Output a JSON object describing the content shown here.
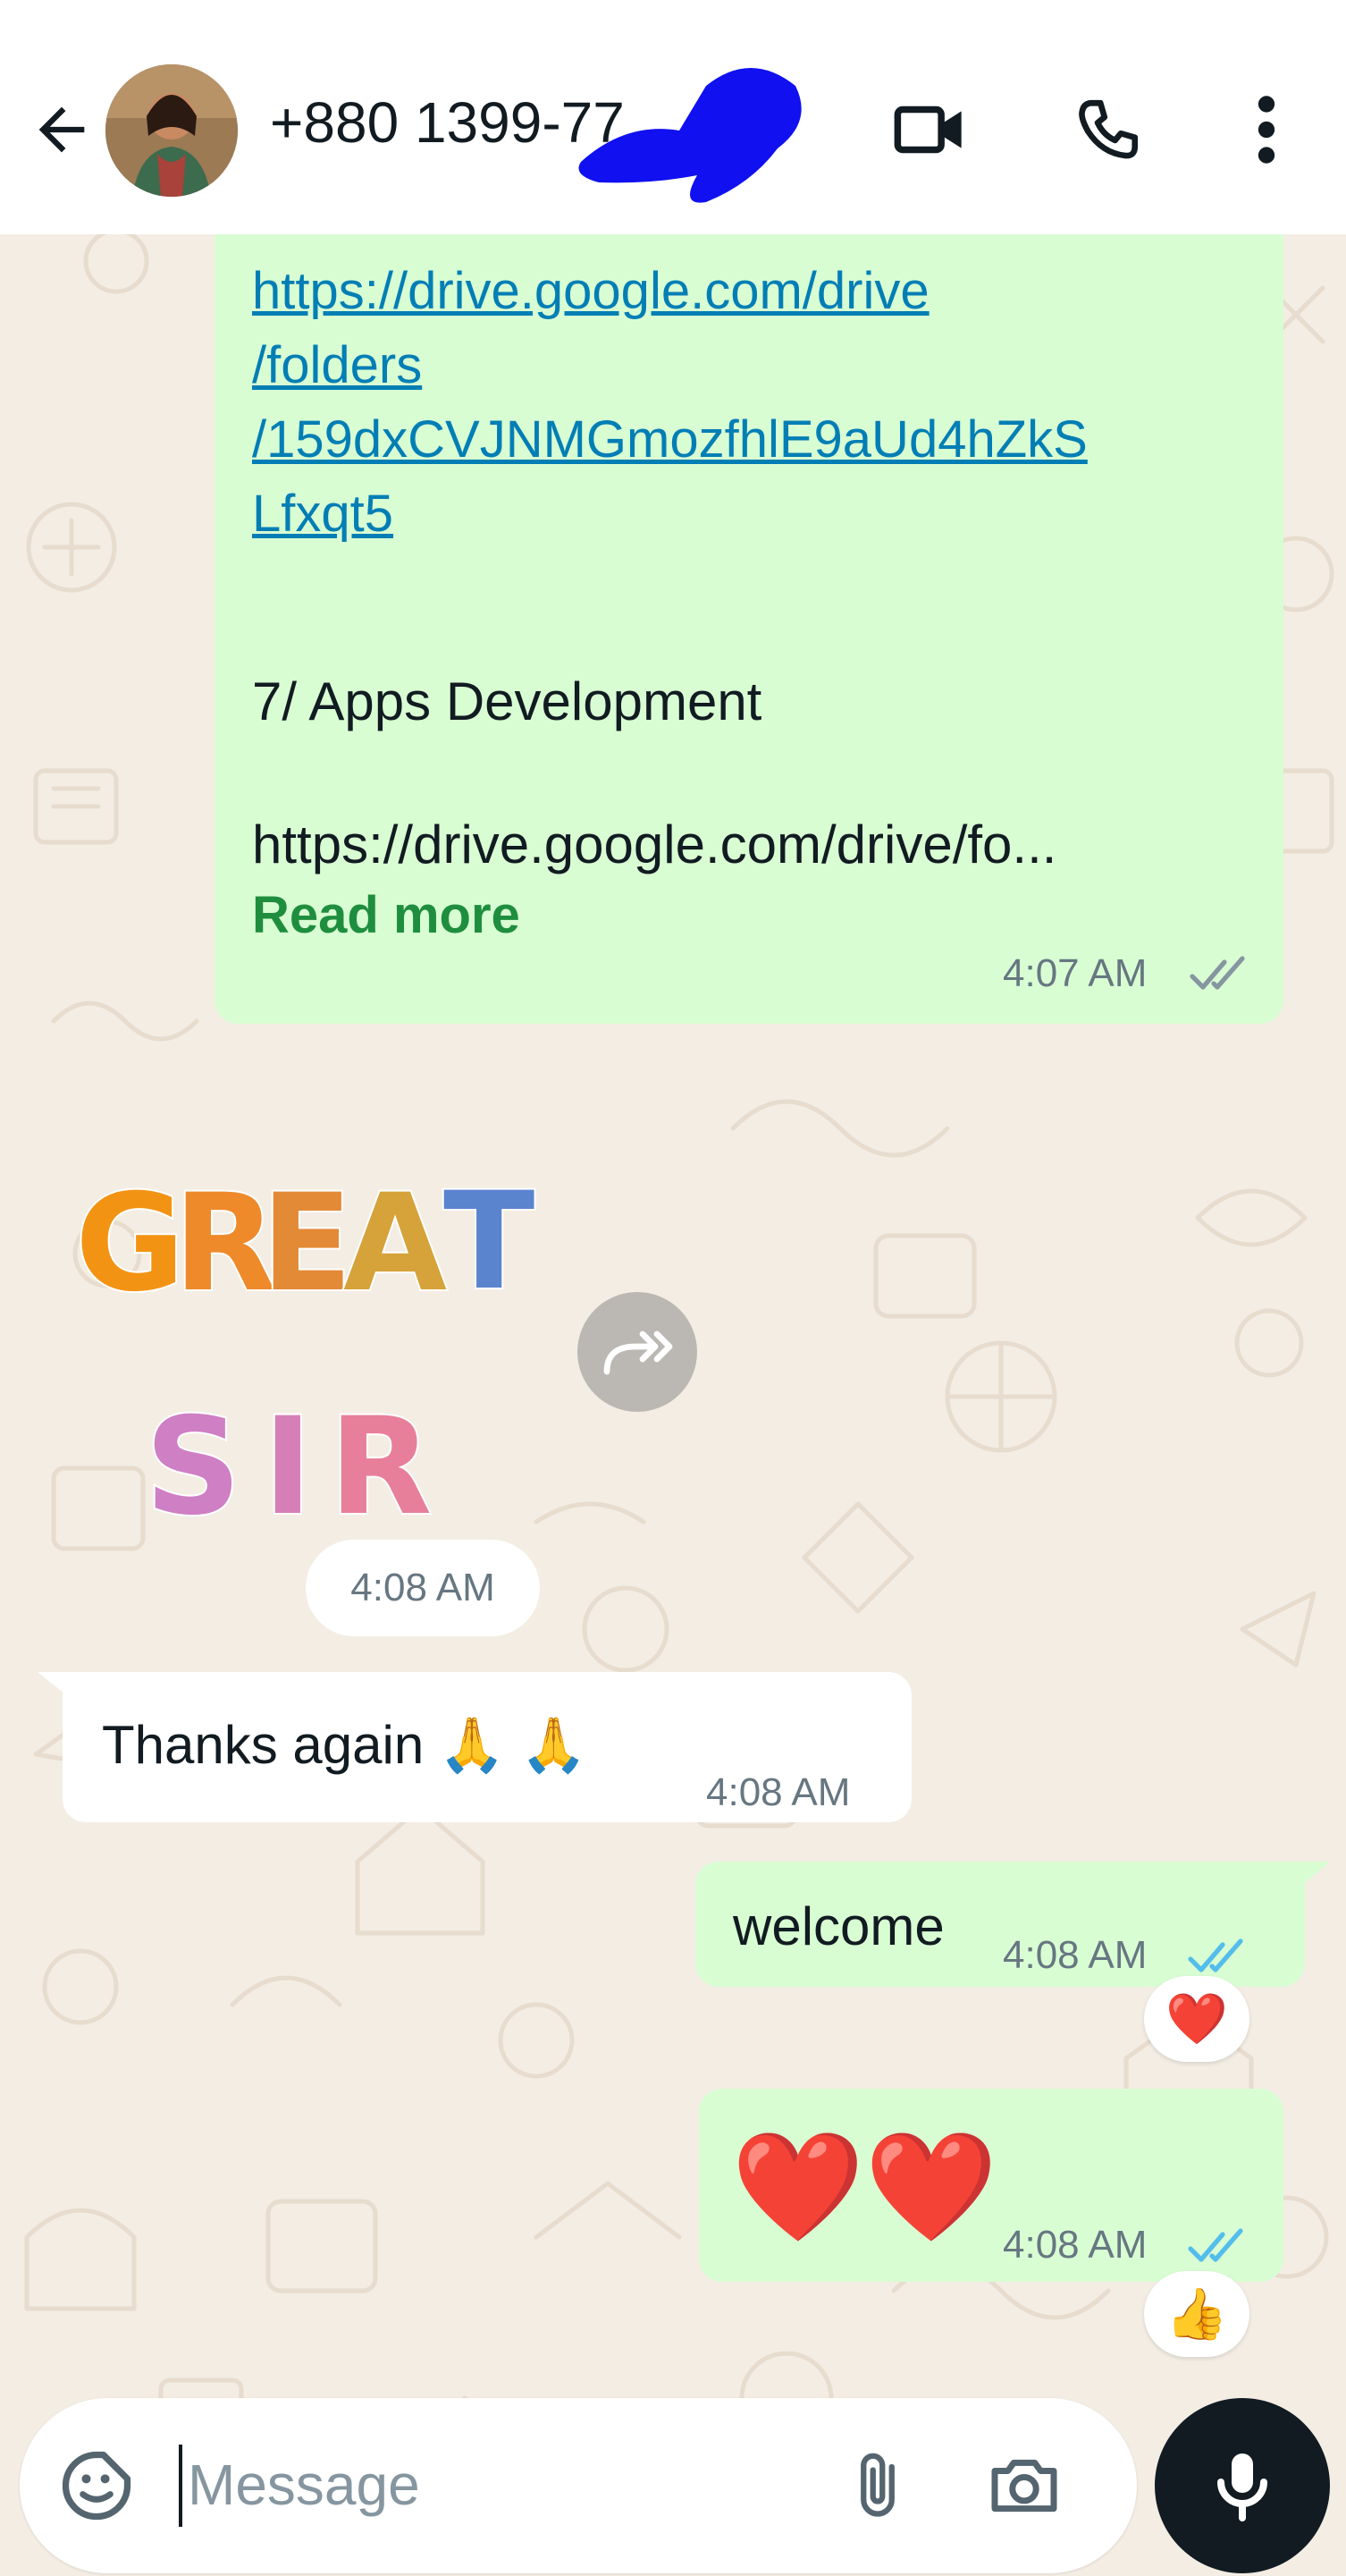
{
  "header": {
    "contact_name": "+880 1399-77",
    "icons": [
      "back-arrow-icon",
      "video-call-icon",
      "phone-icon",
      "more-vert-icon"
    ]
  },
  "messages": {
    "m1": {
      "link_lines": [
        "https://drive.google.com/drive",
        "/folders",
        "/159dxCVJNMGmozfhlE9aUd4hZkS",
        "Lfxqt5"
      ],
      "section": "7/ Apps Development",
      "truncated_url": "https://drive.google.com/drive/fo...",
      "read_more": "Read more",
      "time": "4:07 AM",
      "status": "delivered"
    },
    "sticker": {
      "line1": [
        "G",
        "R",
        "E",
        "A",
        "T"
      ],
      "line2": [
        "S",
        "I",
        "R"
      ],
      "colors": [
        "#f39314",
        "#ee8a2a",
        "#e38a36",
        "#d6a23a",
        "#5b84cf"
      ],
      "colors2": [
        "#cf7fc4",
        "#d57fb6",
        "#e87f9a"
      ],
      "time": "4:08 AM"
    },
    "m3": {
      "text": "Thanks again 🙏 🙏",
      "time": "4:08 AM"
    },
    "m4": {
      "text": "welcome",
      "time": "4:08 AM",
      "reaction": "❤️",
      "status": "read"
    },
    "m5": {
      "text": "❤️❤️",
      "time": "4:08 AM",
      "reaction": "👍",
      "status": "read"
    }
  },
  "composer": {
    "placeholder": "Message",
    "icons": [
      "sticker-icon",
      "attach-icon",
      "camera-icon",
      "mic-icon"
    ]
  },
  "colors": {
    "accent_green": "#00a884",
    "out_bubble": "#d9fdd3",
    "read_tick": "#53bdeb",
    "link": "#027eb5",
    "read_more": "#1e8e3e"
  }
}
